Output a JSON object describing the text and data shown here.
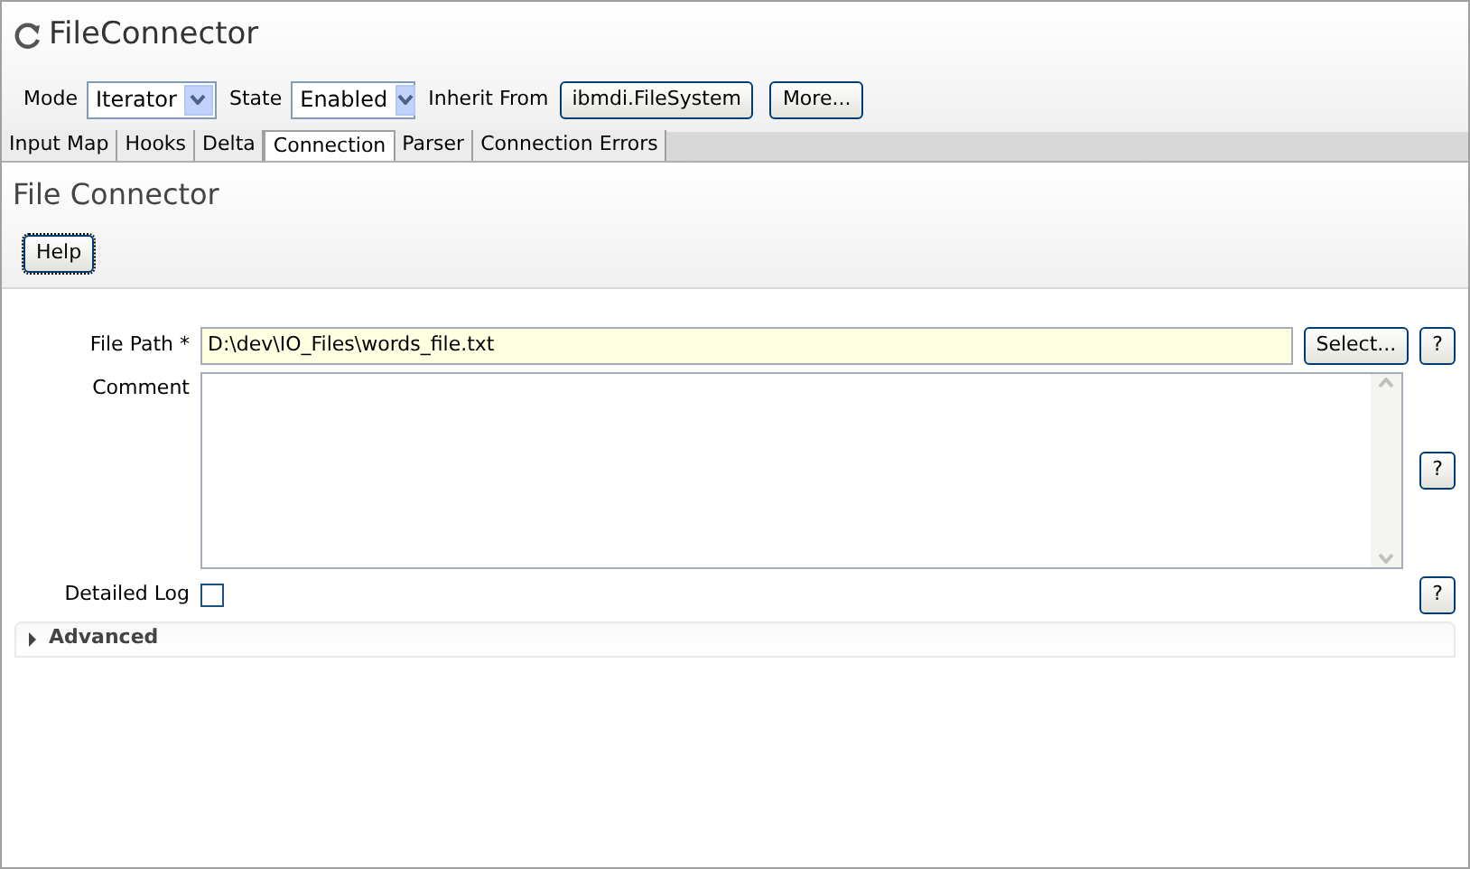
{
  "window": {
    "title": "FileConnector"
  },
  "toolbar": {
    "mode": {
      "label": "Mode",
      "value": "Iterator"
    },
    "state": {
      "label": "State",
      "value": "Enabled"
    },
    "inherit": {
      "label": "Inherit From",
      "value": "ibmdi.FileSystem"
    },
    "more_button": "More..."
  },
  "tabs": [
    {
      "label": "Input Map",
      "selected": false
    },
    {
      "label": "Hooks",
      "selected": false
    },
    {
      "label": "Delta",
      "selected": false
    },
    {
      "label": "Connection",
      "selected": true
    },
    {
      "label": "Parser",
      "selected": false
    },
    {
      "label": "Connection Errors",
      "selected": false
    }
  ],
  "section": {
    "title": "File Connector",
    "help_button": "Help"
  },
  "form": [
    {
      "kind": "text",
      "label": "File Path *",
      "value": "D:\\dev\\IO_Files\\words_file.txt",
      "button": "Select...",
      "help": "?"
    },
    {
      "kind": "textarea",
      "label": "Comment",
      "help": "?"
    },
    {
      "kind": "checkbox",
      "label": "Detailed Log",
      "checked": false,
      "help": "?"
    }
  ],
  "advanced": {
    "label": "Advanced",
    "expanded": false
  }
}
